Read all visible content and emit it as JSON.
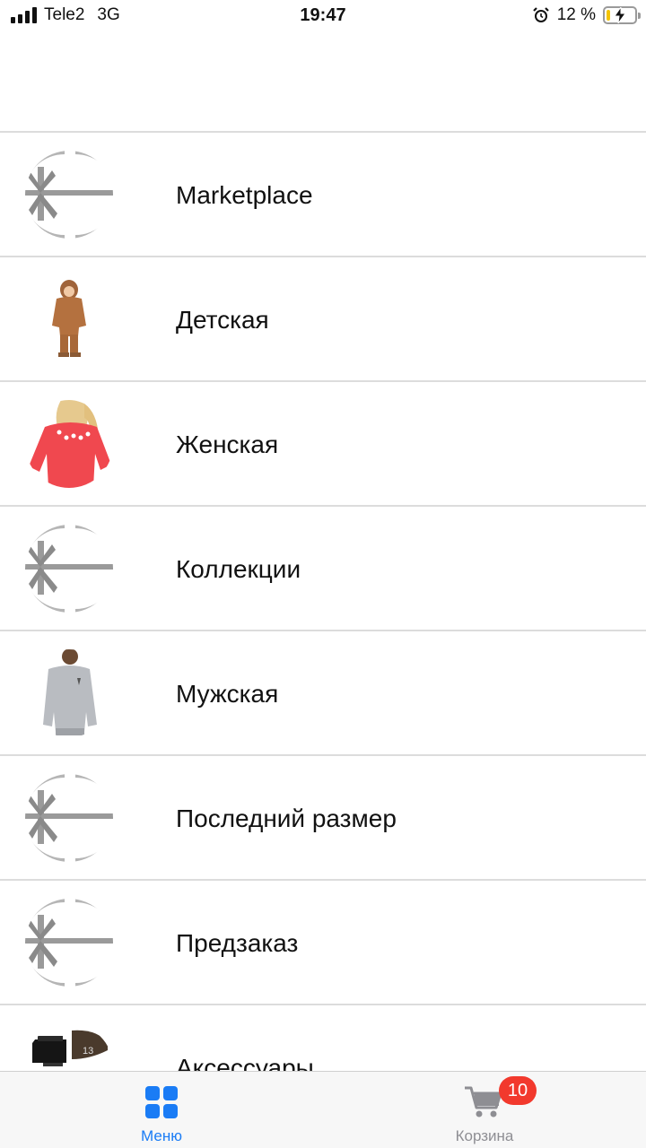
{
  "status_bar": {
    "carrier": "Tele2",
    "network": "3G",
    "time": "19:47",
    "battery": "12 %",
    "battery_level": 0.12,
    "icons": [
      "signal-icon",
      "alarm-icon",
      "battery-icon",
      "charging-bolt-icon"
    ]
  },
  "menu": {
    "items": [
      {
        "label": "Marketplace",
        "thumb": "placeholder-bow-icon"
      },
      {
        "label": "Детская",
        "thumb": "kids-hoodie-photo"
      },
      {
        "label": "Женская",
        "thumb": "women-red-sweatshirt-photo"
      },
      {
        "label": "Коллекции",
        "thumb": "placeholder-bow-icon"
      },
      {
        "label": "Мужская",
        "thumb": "men-gray-sweatshirt-photo"
      },
      {
        "label": "Последний размер",
        "thumb": "placeholder-bow-icon"
      },
      {
        "label": "Предзаказ",
        "thumb": "placeholder-bow-icon"
      },
      {
        "label": "Аксессуары",
        "thumb": "accessories-photo"
      }
    ]
  },
  "tab_bar": {
    "menu_label": "Меню",
    "cart_label": "Корзина",
    "cart_badge": "10",
    "active_color": "#1a7cf5",
    "inactive_color": "#8e8e93",
    "badge_color": "#f2392d"
  }
}
